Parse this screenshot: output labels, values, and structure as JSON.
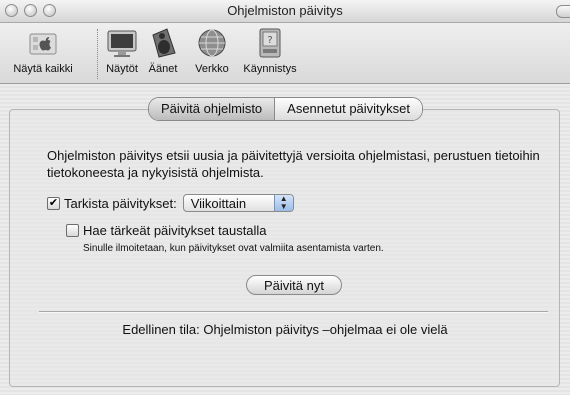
{
  "window": {
    "title": "Ohjelmiston päivitys"
  },
  "toolbar": {
    "show_all": "Näytä kaikki",
    "items": [
      "Näytöt",
      "Äänet",
      "Verkko",
      "Käynnistys"
    ]
  },
  "tabs": [
    "Päivitä ohjelmisto",
    "Asennetut päivitykset"
  ],
  "main": {
    "description": "Ohjelmiston päivitys etsii uusia ja päivitettyjä versioita ohjelmistasi, perustuen tietoihin tietokoneesta ja nykyisistä ohjelmista.",
    "check_label": "Tarkista päivitykset:",
    "check_checked": true,
    "frequency": "Viikoittain",
    "bg_download_label": "Hae tärkeät päivitykset taustalla",
    "bg_download_checked": false,
    "bg_note": "Sinulle ilmoitetaan, kun päivitykset ovat valmiita asentamista varten.",
    "update_now": "Päivitä nyt",
    "status": "Edellinen tila: Ohjelmiston päivitys –ohjelmaa ei ole vielä"
  },
  "icons": {
    "show_all": "apple-grid-icon",
    "displays": "display-icon",
    "sound": "speaker-icon",
    "network": "globe-icon",
    "startup": "hard-disk-icon"
  }
}
